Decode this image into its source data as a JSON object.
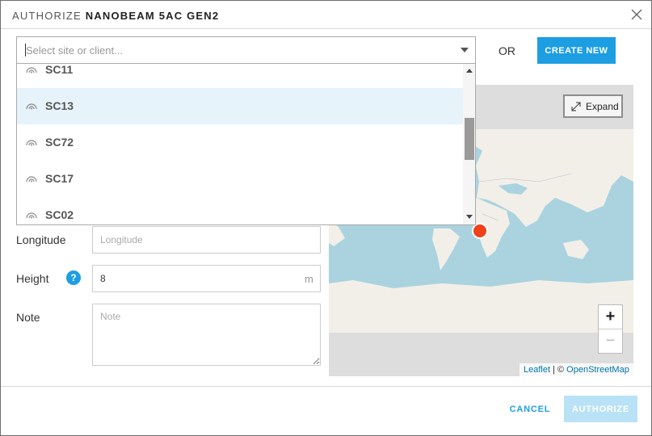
{
  "dialog": {
    "title_prefix": "AUTHORIZE",
    "title_device": "NANOBEAM 5AC GEN2"
  },
  "site_select": {
    "placeholder": "Select site or client...",
    "options": [
      {
        "label": "SC11",
        "icon": "site-icon",
        "selected": false
      },
      {
        "label": "SC13",
        "icon": "site-icon",
        "selected": true
      },
      {
        "label": "SC72",
        "icon": "site-icon",
        "selected": false
      },
      {
        "label": "SC17",
        "icon": "site-icon",
        "selected": false
      },
      {
        "label": "SC02",
        "icon": "site-icon",
        "selected": false
      }
    ]
  },
  "or_label": "OR",
  "create_new_label": "CREATE NEW",
  "form": {
    "longitude": {
      "label": "Longitude",
      "placeholder": "Longitude",
      "value": ""
    },
    "height": {
      "label": "Height",
      "value": "8",
      "unit": "m",
      "help": "?"
    },
    "note": {
      "label": "Note",
      "placeholder": "Note",
      "value": ""
    }
  },
  "map": {
    "expand_label": "Expand",
    "zoom_in": "+",
    "zoom_out": "−",
    "attribution_leaflet": "Leaflet",
    "attribution_sep": " | © ",
    "attribution_osm": "OpenStreetMap"
  },
  "footer": {
    "cancel_label": "CANCEL",
    "authorize_label": "AUTHORIZE"
  },
  "colors": {
    "accent": "#1d9ee3",
    "accent_disabled": "#b9e2f6",
    "selected_row": "#e6f3fb",
    "map_water": "#aad3df",
    "map_land": "#f2efe9",
    "marker": "#f0411a"
  }
}
